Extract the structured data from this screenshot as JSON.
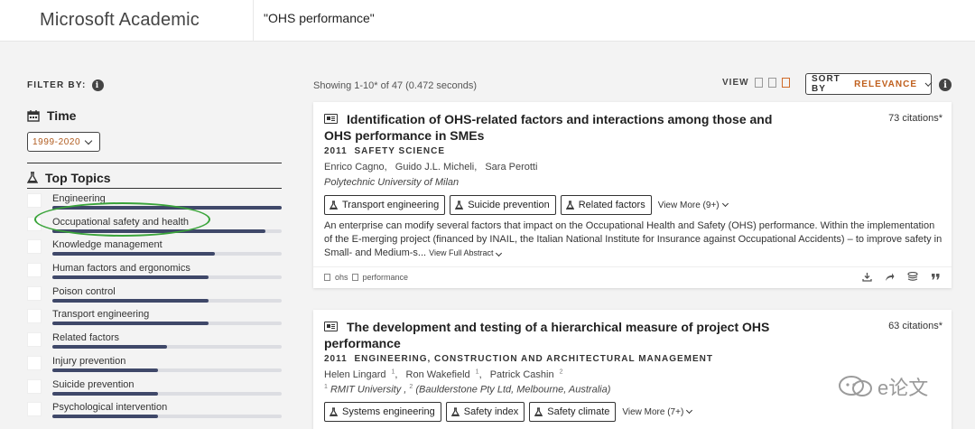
{
  "header": {
    "brand": "Microsoft Academic",
    "search_value": "\"OHS performance\""
  },
  "sidebar": {
    "filter_by": "FILTER BY:",
    "time_label": "Time",
    "time_range": "1999-2020",
    "topics_label": "Top Topics",
    "topics": [
      {
        "name": "Engineering",
        "fraction": 1.0
      },
      {
        "name": "Occupational safety and health",
        "fraction": 0.93
      },
      {
        "name": "Knowledge management",
        "fraction": 0.71
      },
      {
        "name": "Human factors and ergonomics",
        "fraction": 0.68
      },
      {
        "name": "Poison control",
        "fraction": 0.68
      },
      {
        "name": "Transport engineering",
        "fraction": 0.68
      },
      {
        "name": "Related factors",
        "fraction": 0.5
      },
      {
        "name": "Injury prevention",
        "fraction": 0.46
      },
      {
        "name": "Suicide prevention",
        "fraction": 0.46
      },
      {
        "name": "Psychological intervention",
        "fraction": 0.46
      }
    ]
  },
  "results": {
    "showing": "Showing 1-10* of 47 (0.472 seconds)",
    "view_label": "VIEW",
    "sort_key": "SORT BY",
    "sort_value": "RELEVANCE",
    "papers": [
      {
        "title": "Identification of OHS-related factors and interactions among those and OHS performance in SMEs",
        "citations": "73 citations*",
        "year": "2011",
        "venue": "SAFETY SCIENCE",
        "authors": [
          "Enrico Cagno,",
          "Guido J.L. Micheli,",
          "Sara Perotti"
        ],
        "affiliation": "Polytechnic University of Milan",
        "tags": [
          "Transport engineering",
          "Suicide prevention",
          "Related factors"
        ],
        "view_more": "View More (9+)",
        "abstract": "An enterprise can modify several factors that impact on the Occupational Health and Safety (OHS) performance. Within the implementation of the E-merging project (financed by INAIL, the Italian National Institute for Insurance against Occupational Accidents) – to improve safety in Small- and Medium-s...",
        "view_full_abstract": "View Full Abstract",
        "keywords": [
          "ohs",
          "performance"
        ]
      },
      {
        "title": "The development and testing of a hierarchical measure of project OHS performance",
        "citations": "63 citations*",
        "year": "2011",
        "venue": "ENGINEERING, CONSTRUCTION AND ARCHITECTURAL MANAGEMENT",
        "authors": [
          "Helen Lingard",
          "Ron Wakefield",
          "Patrick Cashin"
        ],
        "author_sup": [
          "1",
          "1",
          "2"
        ],
        "affiliations": [
          {
            "sup": "1",
            "name": "RMIT University ,"
          },
          {
            "sup": "2",
            "name": "(Baulderstone Pty Ltd, Melbourne, Australia)"
          }
        ],
        "tags": [
          "Systems engineering",
          "Safety index",
          "Safety climate"
        ],
        "view_more": "View More (7+)"
      }
    ]
  },
  "watermark": {
    "text": "e论文"
  }
}
